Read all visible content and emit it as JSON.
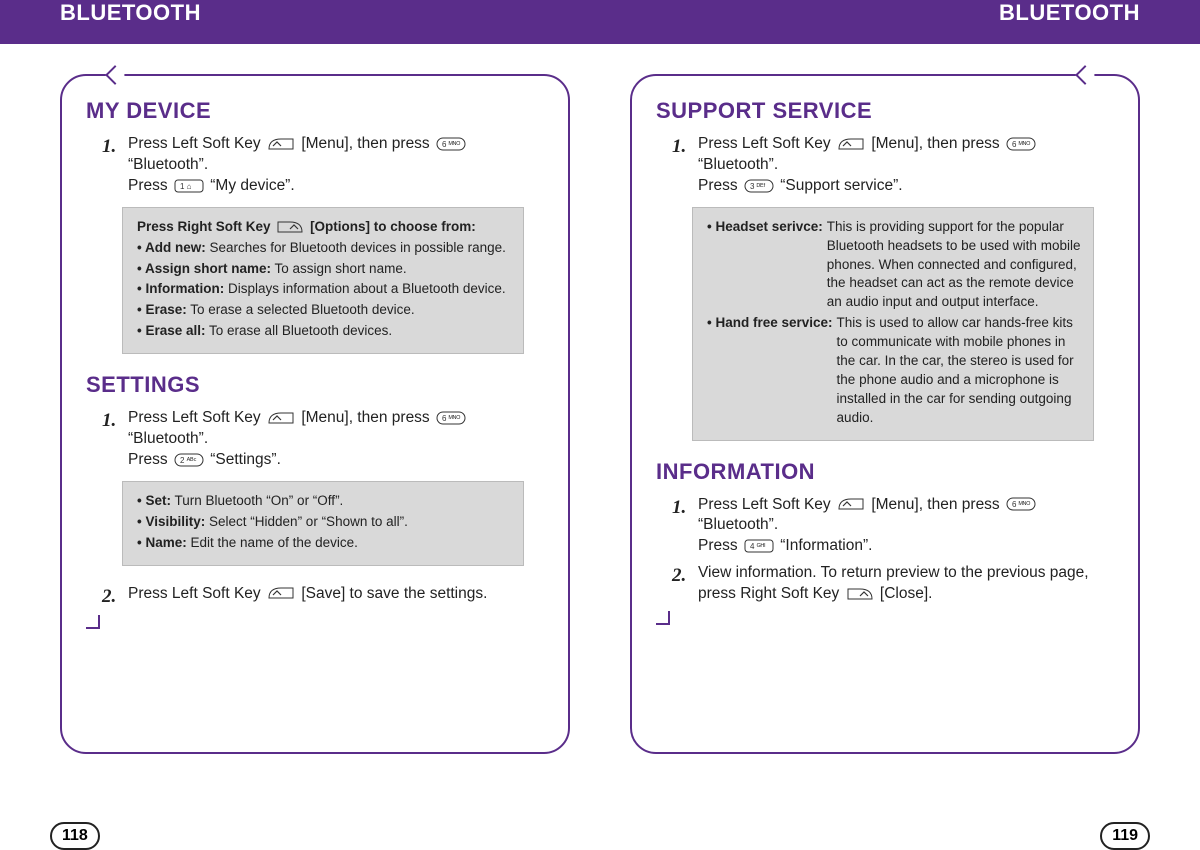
{
  "header": {
    "left": "BLUETOOTH",
    "right": "BLUETOOTH"
  },
  "left_page": {
    "number": "118",
    "sections": {
      "my_device": {
        "title": "MY DEVICE",
        "step1_a": "Press Left Soft Key",
        "step1_b": "[Menu], then press",
        "step1_c": "“Bluetooth”.",
        "step1_d": "Press",
        "step1_e": "“My device”.",
        "box_intro": "Press Right Soft Key",
        "box_intro2": "[Options] to choose from:",
        "items": [
          {
            "label": "• Add new:",
            "text": "Searches for Bluetooth devices in possible range."
          },
          {
            "label": "• Assign short name:",
            "text": "To assign short name."
          },
          {
            "label": "• Information:",
            "text": "Displays information about a Bluetooth device."
          },
          {
            "label": "• Erase:",
            "text": "To erase a selected Bluetooth device."
          },
          {
            "label": "• Erase all:",
            "text": "To erase all Bluetooth devices."
          }
        ]
      },
      "settings": {
        "title": "SETTINGS",
        "step1_a": "Press Left Soft Key",
        "step1_b": "[Menu], then press",
        "step1_c": "“Bluetooth”.",
        "step1_d": "Press",
        "step1_e": "“Settings”.",
        "items": [
          {
            "label": "• Set:",
            "text": "Turn Bluetooth “On” or “Off”."
          },
          {
            "label": "• Visibility:",
            "text": "Select “Hidden” or “Shown to all”."
          },
          {
            "label": "• Name:",
            "text": "Edit the name of the device."
          }
        ],
        "step2_a": "Press Left Soft Key",
        "step2_b": "[Save] to save the settings."
      }
    }
  },
  "right_page": {
    "number": "119",
    "sections": {
      "support": {
        "title": "SUPPORT SERVICE",
        "step1_a": "Press Left Soft Key",
        "step1_b": "[Menu], then press",
        "step1_c": "“Bluetooth”.",
        "step1_d": "Press",
        "step1_e": "“Support service”.",
        "items": [
          {
            "label": "• Headset serivce:",
            "text": "This is providing support for the popular Bluetooth headsets to be used with mobile phones. When connected and configured, the headset can act as the remote device an audio input and output interface."
          },
          {
            "label": "• Hand free service:",
            "text": "This is used to allow car hands-free kits to communicate with mobile phones in the car. In the car, the stereo is used for the phone audio and a microphone is installed in the car for sending outgoing audio."
          }
        ]
      },
      "information": {
        "title": "INFORMATION",
        "step1_a": "Press Left Soft Key",
        "step1_b": "[Menu], then press",
        "step1_c": "“Bluetooth”.",
        "step1_d": "Press",
        "step1_e": "“Information”.",
        "step2_a": "View information. To return preview to the previous page,",
        "step2_b": "press Right Soft Key",
        "step2_c": "[Close]."
      }
    }
  },
  "icons": {
    "left_soft": "left-soft-key-icon",
    "right_soft": "right-soft-key-icon",
    "key1": "key-1-icon",
    "key2": "key-2-icon",
    "key3": "key-3-icon",
    "key4": "key-4-icon",
    "key6": "key-6-icon"
  }
}
